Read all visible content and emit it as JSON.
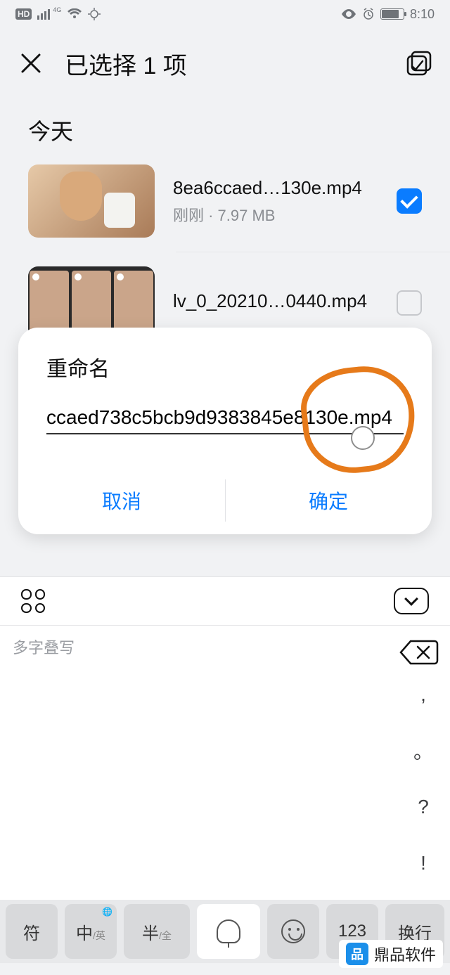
{
  "status": {
    "time": "8:10"
  },
  "header": {
    "title": "已选择 1 项"
  },
  "section": {
    "today": "今天"
  },
  "items": [
    {
      "name": "8ea6ccaed…130e.mp4",
      "sub": "刚刚 · 7.97 MB",
      "checked": true
    },
    {
      "name": "lv_0_20210…0440.mp4",
      "sub": "",
      "checked": false
    }
  ],
  "dialog": {
    "title": "重命名",
    "value": "ccaed738c5bcb9d9383845e8130e.mp4",
    "cancel": "取消",
    "confirm": "确定"
  },
  "ime": {
    "hint": "多字叠写",
    "side": [
      ",",
      "。",
      "?",
      "!"
    ]
  },
  "kbd": {
    "sym": "符",
    "cn": "中",
    "cn_sub": "/英",
    "half": "半",
    "half_sub": "/全",
    "num": "123",
    "enter": "换行"
  },
  "watermark": {
    "logo": "品",
    "text": "鼎品软件"
  }
}
